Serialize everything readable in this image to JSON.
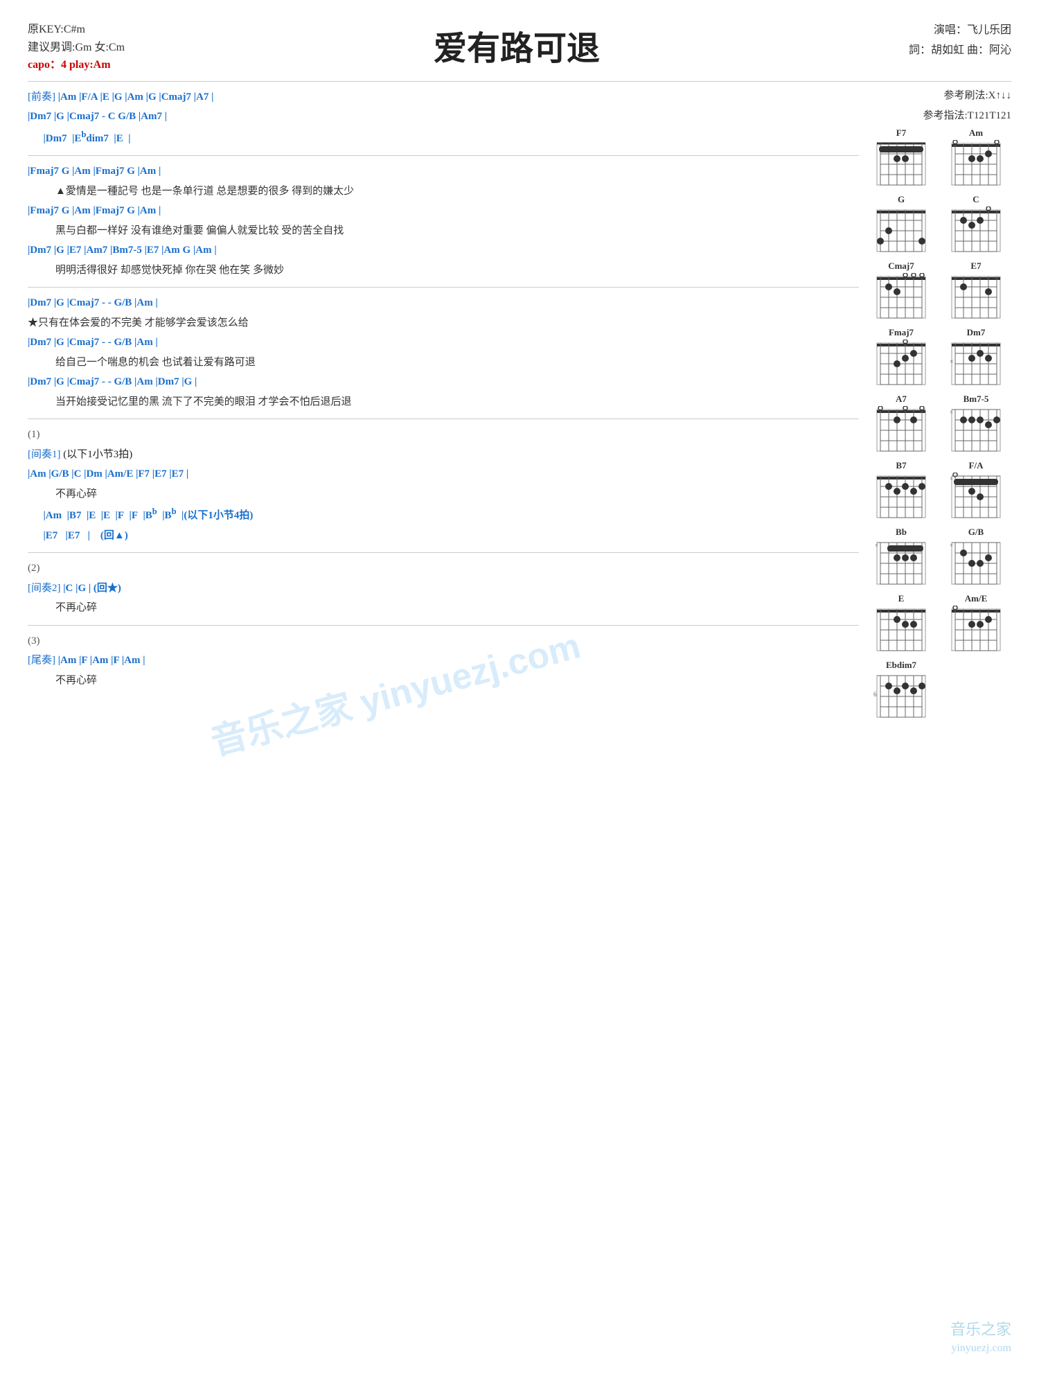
{
  "header": {
    "key_original": "原KEY:C#m",
    "key_suggestion": "建议男调:Gm 女:Cm",
    "capo": "capo：4 play:Am",
    "title": "爱有路可退",
    "performer": "演唱：飞儿乐团",
    "words": "詞：胡如虹  曲：阿沁"
  },
  "ref": {
    "strum": "参考刷法:X↑↓↓",
    "fingering": "参考指法:T121T121"
  },
  "sections": {
    "prelude_label": "[前奏]",
    "prelude_line1": "|Am  |F/A  |E   |G  |Am  |G  |Cmaj7  |A7  |",
    "prelude_line2": "      |Dm7  |G   |Cmaj7 - C  G/B  |Am7  |",
    "prelude_line3": "      |Dm7  |Eᵇdim7  |E  |",
    "verse1_chords1": "|Fmaj7    G        |Am                         |Fmaj7   G     |Am                |",
    "verse1_lyrics1": "▲愛情是一種記号    也是一条单行道    总是想要的很多    得到的嫌太少",
    "verse1_chords2": "|Fmaj7    G        |Am                         |Fmaj7   G     |Am                |",
    "verse1_lyrics2": "    黑与白都一样好    没有谁绝对重要    偏偏人就爱比较    受的苦全自找",
    "verse1_chords3": "|Dm7   |G      |E7     |Am7   |Bm7-5   |E7              |Am   G  |Am   |",
    "verse1_lyrics3": "    明明活得很好    却感觉快死掉        你在哭    他在笑    多微妙",
    "chorus_chords1": "               |Dm7       |G                   |Cmaj7 - - G/B |Am  |",
    "chorus_lyrics1": "★只有在体会爱的不完美    才能够学会爱该怎么给",
    "chorus_chords2": "               |Dm7       |G                   |Cmaj7 - - G/B |Am  |",
    "chorus_lyrics2": "    给自己一个喘息的机会    也试着让爱有路可退",
    "chorus_chords3": "               |Dm7   |G          |Cmaj7 - - G/B  |Am        |Dm7   |G  |",
    "chorus_lyrics3": "    当开始接受记忆里的黑    流下了不完美的眼泪              才学会不怕后退后退",
    "paren1": "(1)",
    "interlude1_label": "[间奏1]",
    "interlude1_sub": "(以下1小节3拍)",
    "interlude1_line1": "           |Am   |G/B  |C   |Dm   |Am/E  |F7  |E7  |E7  |",
    "interlude1_lyric1": "    不再心碎",
    "interlude1_line2": "      |Am   |B7   |E   |E   |F   |F   |Bᵇ  |Bᵇ   |(以下1小节4拍)",
    "interlude1_line3": "      |E7   |E7   |    (回▲)",
    "paren2": "(2)",
    "interlude2_label": "[间奏2]",
    "interlude2_line1": "|C       |G    |    (回★)",
    "interlude2_lyric1": "    不再心碎",
    "paren3": "(3)",
    "outro_label": "[尾奏]",
    "outro_line1": "|Am    |F   |Am   |F   |Am   |",
    "outro_lyric1": "    不再心碎"
  },
  "chords": [
    {
      "name": "F7",
      "frets": [
        1,
        1,
        2,
        2,
        1,
        1
      ],
      "barre": 1,
      "open": []
    },
    {
      "name": "Am",
      "frets": [
        0,
        0,
        2,
        2,
        1,
        0
      ],
      "barre": 0,
      "open": [
        0,
        5
      ]
    },
    {
      "name": "G",
      "frets": [
        3,
        2,
        0,
        0,
        0,
        3
      ],
      "barre": 0
    },
    {
      "name": "C",
      "frets": [
        0,
        3,
        2,
        0,
        1,
        0
      ],
      "barre": 0
    },
    {
      "name": "Cmaj7",
      "frets": [
        0,
        3,
        2,
        0,
        0,
        0
      ],
      "barre": 0
    },
    {
      "name": "E7",
      "frets": [
        0,
        2,
        0,
        1,
        0,
        0
      ],
      "barre": 0
    },
    {
      "name": "Fmaj7",
      "frets": [
        0,
        0,
        3,
        2,
        1,
        0
      ],
      "barre": 0
    },
    {
      "name": "Dm7",
      "frets": [
        1,
        1,
        2,
        0,
        1,
        1
      ],
      "barre": 1
    },
    {
      "name": "A7",
      "frets": [
        0,
        0,
        2,
        0,
        2,
        0
      ],
      "barre": 0
    },
    {
      "name": "Bm7-5",
      "frets": [
        2,
        3,
        2,
        2,
        1,
        1
      ],
      "barre": 1
    },
    {
      "name": "B7",
      "frets": [
        2,
        1,
        2,
        1,
        2,
        2
      ],
      "barre": 2
    },
    {
      "name": "F/A",
      "frets": [
        0,
        1,
        1,
        2,
        3,
        1
      ],
      "barre": 1
    },
    {
      "name": "Bb",
      "frets": [
        1,
        1,
        3,
        3,
        3,
        1
      ],
      "barre": 1
    },
    {
      "name": "G/B",
      "frets": [
        2,
        3,
        4,
        4,
        3,
        2
      ],
      "barre": 2
    },
    {
      "name": "E",
      "frets": [
        0,
        0,
        1,
        2,
        2,
        0
      ],
      "barre": 0
    },
    {
      "name": "Am/E",
      "frets": [
        0,
        0,
        2,
        2,
        1,
        0
      ],
      "barre": 0
    },
    {
      "name": "Ebdim7",
      "frets": [
        6,
        7,
        5,
        6,
        5,
        6
      ],
      "barre": 5
    }
  ]
}
